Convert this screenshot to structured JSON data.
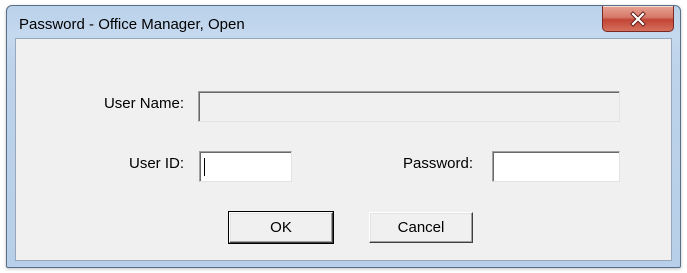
{
  "window": {
    "title": "Password - Office Manager, Open"
  },
  "form": {
    "user_name_label": "User Name:",
    "user_name_value": "",
    "user_id_label": "User ID:",
    "user_id_value": "",
    "password_label": "Password:",
    "password_value": ""
  },
  "buttons": {
    "ok_label": "OK",
    "cancel_label": "Cancel"
  },
  "icons": {
    "close": "close-icon"
  },
  "colors": {
    "close_button": "#c7473a",
    "titlebar": "#bcd3ea",
    "dialog_face": "#f0f0f0"
  }
}
